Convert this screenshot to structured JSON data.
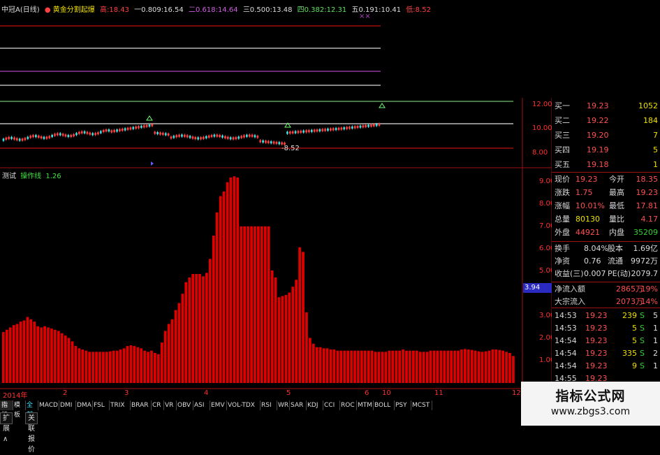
{
  "header": {
    "title": "中冠A(日线)",
    "indicator_name": "黄金分割起爆",
    "high_label": "高:",
    "high_value": "18.43",
    "one_label": "一0.809:",
    "one_value": "16.54",
    "two_label": "二0.618:",
    "two_value": "14.64",
    "three_label": "三0.500:",
    "three_value": "13.48",
    "four_label": "四0.382:",
    "four_value": "12.31",
    "five_label": "五0.191:",
    "five_value": "10.41",
    "low_label": "低:",
    "low_value": "8.52",
    "close_mark": "××"
  },
  "price_chart": {
    "axis_labels": [
      "12.00",
      "10.00",
      "8.00"
    ],
    "low_annotation": "-8.52",
    "colors": {
      "gold": "#70ff70",
      "white": "#e0e0e0",
      "purple": "#b040c0",
      "red": "#c01010"
    }
  },
  "indicator": {
    "name": "测试",
    "line_name": "操作线",
    "value": "1.26",
    "axis_labels": [
      "9.00",
      "8.00",
      "7.00",
      "6.00",
      "5.00",
      "4.00",
      "3.00",
      "2.00",
      "1.00"
    ],
    "current_marker": "3.94"
  },
  "chart_data": {
    "type": "bar",
    "title": "",
    "ylim": [
      0.5,
      9.5
    ],
    "values": [
      2.35,
      2.45,
      2.55,
      2.65,
      2.7,
      2.8,
      2.85,
      3.0,
      2.9,
      2.8,
      2.6,
      2.55,
      2.6,
      2.55,
      2.5,
      2.45,
      2.4,
      2.3,
      2.2,
      2.1,
      1.95,
      1.75,
      1.65,
      1.6,
      1.55,
      1.5,
      1.5,
      1.5,
      1.5,
      1.5,
      1.5,
      1.52,
      1.55,
      1.55,
      1.6,
      1.65,
      1.75,
      1.78,
      1.75,
      1.7,
      1.65,
      1.55,
      1.5,
      1.55,
      1.45,
      1.4,
      1.9,
      2.4,
      2.7,
      2.9,
      3.3,
      3.6,
      4.0,
      4.5,
      4.7,
      4.85,
      4.85,
      4.85,
      4.75,
      4.9,
      5.5,
      6.5,
      7.5,
      8.2,
      8.4,
      8.8,
      9.0,
      9.05,
      9.0,
      6.9,
      6.9,
      6.9,
      6.9,
      6.9,
      6.9,
      6.9,
      6.9,
      6.9,
      5.0,
      4.7,
      3.85,
      3.9,
      3.95,
      4.05,
      4.3,
      4.6,
      6.0,
      5.8,
      3.2,
      2.1,
      1.85,
      1.7,
      1.7,
      1.65,
      1.65,
      1.6,
      1.6,
      1.55,
      1.55,
      1.55,
      1.55,
      1.55,
      1.55,
      1.55,
      1.55,
      1.55,
      1.55,
      1.55,
      1.5,
      1.5,
      1.5,
      1.5,
      1.55,
      1.55,
      1.55,
      1.55,
      1.6,
      1.55,
      1.55,
      1.55,
      1.55,
      1.5,
      1.5,
      1.5,
      1.55,
      1.55,
      1.55,
      1.55,
      1.55,
      1.55,
      1.55,
      1.55,
      1.55,
      1.6,
      1.62,
      1.6,
      1.58,
      1.55,
      1.52,
      1.5,
      1.52,
      1.55,
      1.6,
      1.6,
      1.58,
      1.55,
      1.5,
      1.45,
      1.32
    ],
    "x_ticks": [
      "2014年",
      "2",
      "3",
      "4",
      "5",
      "6",
      "10",
      "11",
      "12"
    ]
  },
  "order_book": {
    "rows": [
      {
        "label": "买一",
        "price": "19.23",
        "vol": "1052"
      },
      {
        "label": "买二",
        "price": "19.22",
        "vol": "184"
      },
      {
        "label": "买三",
        "price": "19.20",
        "vol": "7"
      },
      {
        "label": "买四",
        "price": "19.19",
        "vol": "5"
      },
      {
        "label": "买五",
        "price": "19.18",
        "vol": "1"
      }
    ]
  },
  "quote": {
    "rows": [
      {
        "l1": "现价",
        "v1": "19.23",
        "l2": "今开",
        "v2": "18.35"
      },
      {
        "l1": "涨跌",
        "v1": "1.75",
        "l2": "最高",
        "v2": "19.23"
      },
      {
        "l1": "涨幅",
        "v1": "10.01%",
        "l2": "最低",
        "v2": "17.81"
      },
      {
        "l1": "总量",
        "v1": "80130",
        "l2": "量比",
        "v2": "4.17"
      },
      {
        "l1": "外盘",
        "v1": "44921",
        "l2": "内盘",
        "v2": "35209"
      }
    ]
  },
  "fundamentals": {
    "rows": [
      {
        "l1": "换手",
        "v1": "8.04%",
        "l2": "股本",
        "v2": "1.69亿"
      },
      {
        "l1": "净资",
        "v1": "0.76",
        "l2": "流通",
        "v2": "9972万"
      },
      {
        "l1": "收益(三)",
        "v1": "0.007",
        "l2": "PE(动)",
        "v2": "2079.7"
      }
    ]
  },
  "flow": {
    "rows": [
      {
        "label": "净流入额",
        "value": "2865万",
        "pct": "19%"
      },
      {
        "label": "大宗流入",
        "value": "2073万",
        "pct": "14%"
      }
    ]
  },
  "ticks": {
    "rows": [
      {
        "time": "14:53",
        "price": "19.23",
        "vol": "239",
        "side": "S",
        "n": "5"
      },
      {
        "time": "14:53",
        "price": "19.23",
        "vol": "5",
        "side": "S",
        "n": "1"
      },
      {
        "time": "14:54",
        "price": "19.23",
        "vol": "5",
        "side": "S",
        "n": "1"
      },
      {
        "time": "14:54",
        "price": "19.23",
        "vol": "335",
        "side": "S",
        "n": "2"
      },
      {
        "time": "14:54",
        "price": "19.23",
        "vol": "9",
        "side": "S",
        "n": "1"
      },
      {
        "time": "14:55",
        "price": "19.23",
        "vol": "",
        "side": "",
        "n": ""
      }
    ]
  },
  "tabs": {
    "items": [
      "指标",
      "模板",
      "全部",
      "MACD",
      "DMI",
      "DMA",
      "FSL",
      "TRIX",
      "BRAR",
      "CR",
      "VR",
      "OBV",
      "ASI",
      "EMV",
      "VOL-TDX",
      "RSI",
      "WR",
      "SAR",
      "KDJ",
      "CCI",
      "ROC",
      "MTM",
      "BOLL",
      "PSY",
      "MCST"
    ]
  },
  "bottom_tabs": {
    "expand": "扩展∧",
    "related": "关联报价"
  },
  "watermark": {
    "line1": "指标公式网",
    "line2": "www.zbgs3.com"
  }
}
